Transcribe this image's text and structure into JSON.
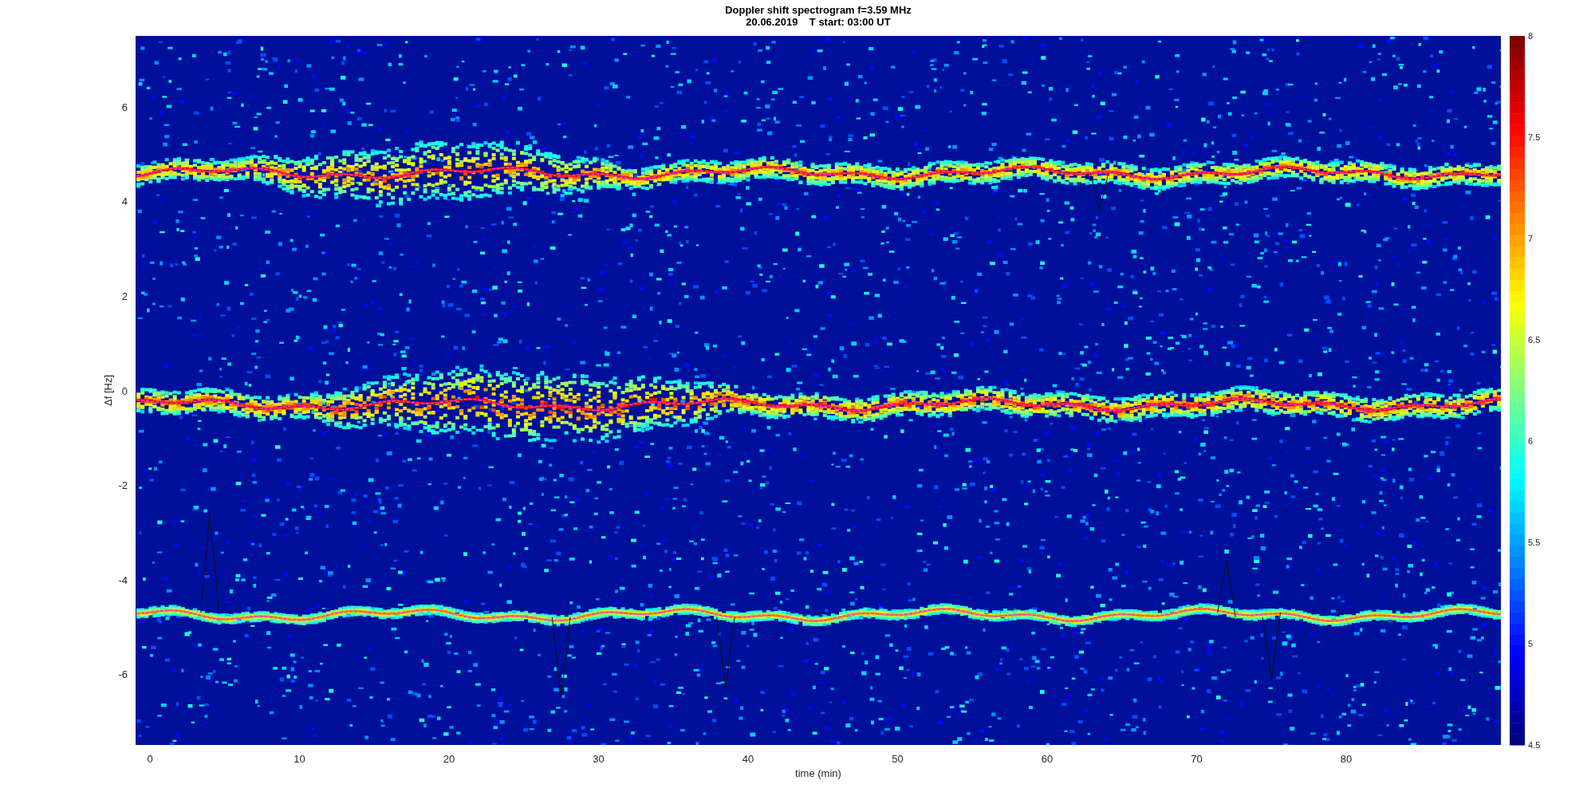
{
  "figure": {
    "title": "Doppler shift spectrogram f=3.59 MHz",
    "subtitle": "20.06.2019    T start: 03:00 UT",
    "xlabel": "time (min)",
    "ylabel": "Δf [Hz]",
    "xticks": [
      "0",
      "10",
      "20",
      "30",
      "40",
      "50",
      "60",
      "70",
      "80"
    ],
    "yticks": [
      "6",
      "4",
      "2",
      "0",
      "-2",
      "-4",
      "-6"
    ],
    "colorbar_ticks": [
      "8",
      "7.5",
      "7",
      "6.5",
      "6",
      "5.5",
      "5",
      "4.5"
    ]
  }
}
